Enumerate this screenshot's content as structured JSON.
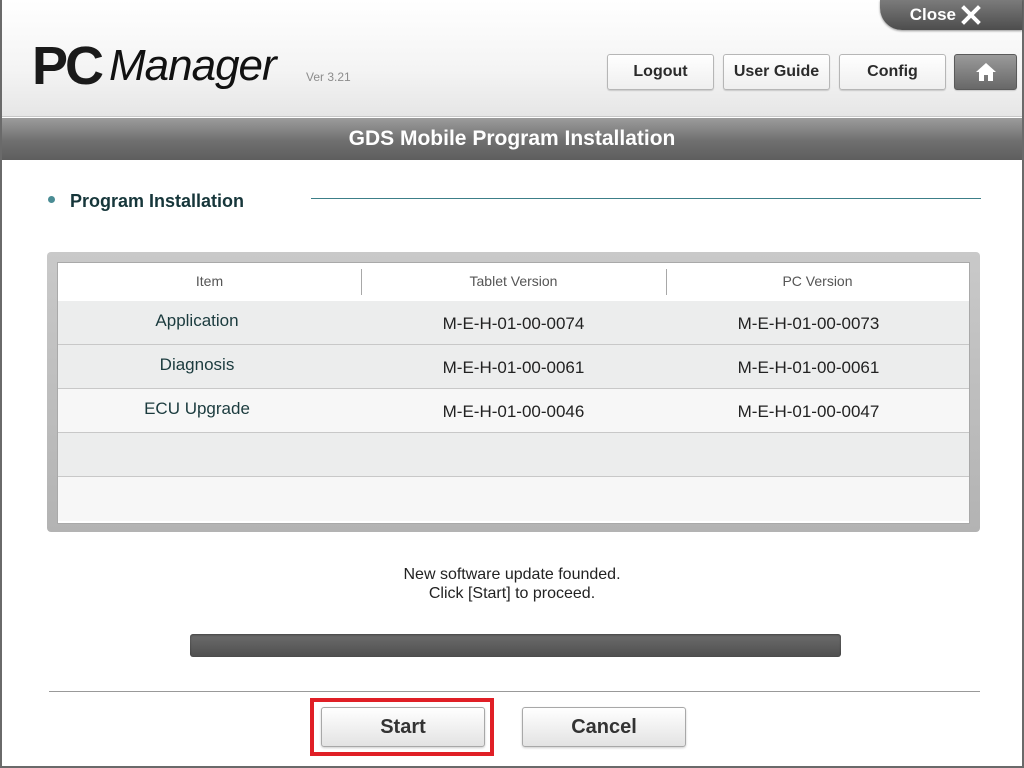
{
  "header": {
    "close_label": "Close",
    "logo_pc": "PC",
    "logo_manager": "Manager",
    "version": "Ver 3.21",
    "buttons": {
      "logout": "Logout",
      "user_guide": "User Guide",
      "config": "Config"
    },
    "home_icon": "home-icon"
  },
  "title": "GDS Mobile Program Installation",
  "section": {
    "title": "Program Installation"
  },
  "table": {
    "columns": [
      "Item",
      "Tablet Version",
      "PC Version"
    ],
    "rows": [
      {
        "item": "Application",
        "tablet": "M-E-H-01-00-0074",
        "pc": "M-E-H-01-00-0073"
      },
      {
        "item": "Diagnosis",
        "tablet": "M-E-H-01-00-0061",
        "pc": "M-E-H-01-00-0061"
      },
      {
        "item": "ECU Upgrade",
        "tablet": "M-E-H-01-00-0046",
        "pc": "M-E-H-01-00-0047"
      },
      {
        "item": "",
        "tablet": "",
        "pc": ""
      },
      {
        "item": "",
        "tablet": "",
        "pc": ""
      }
    ]
  },
  "message": {
    "line1": "New software update founded.",
    "line2": "Click [Start] to proceed."
  },
  "progress": {
    "value": 0
  },
  "footer": {
    "start_label": "Start",
    "cancel_label": "Cancel"
  },
  "colors": {
    "accent_line": "#3c7f88",
    "highlight": "#e01f26",
    "titlebar": "#6f6f6f"
  }
}
